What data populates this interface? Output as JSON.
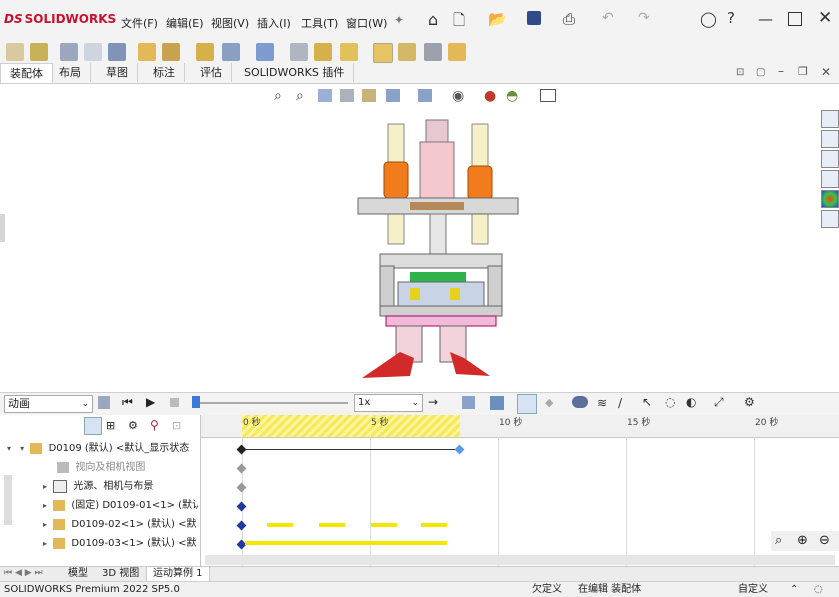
{
  "app": {
    "logo_text": "SOLIDWORKS",
    "menus": [
      "文件(F)",
      "编辑(E)",
      "视图(V)",
      "插入(I)",
      "工具(T)",
      "窗口(W)"
    ]
  },
  "command_tabs": [
    "装配体",
    "布局",
    "草图",
    "标注",
    "评估",
    "SOLIDWORKS 插件"
  ],
  "motion": {
    "study_type": "动画",
    "speed": "1x",
    "ruler_ticks": [
      "0 秒",
      "5 秒",
      "10 秒",
      "15 秒",
      "20 秒"
    ]
  },
  "tree": [
    {
      "label": "D0109 (默认) <默认_显示状态",
      "icon": "assembly-icon",
      "twisty": "▾",
      "indent": 0
    },
    {
      "label": "视向及相机视图",
      "icon": "camera-icon",
      "twisty": "",
      "indent": 1,
      "grey": true
    },
    {
      "label": "光源、相机与布景",
      "icon": "lights-folder-icon",
      "twisty": "▸",
      "indent": 1
    },
    {
      "label": "(固定) D0109-01<1> (默认",
      "icon": "subassembly-icon",
      "twisty": "▸",
      "indent": 1
    },
    {
      "label": "D0109-02<1> (默认) <默",
      "icon": "subassembly-icon",
      "twisty": "▸",
      "indent": 1
    },
    {
      "label": "D0109-03<1> (默认) <默",
      "icon": "subassembly-icon",
      "twisty": "▸",
      "indent": 1
    }
  ],
  "bottom_tabs": [
    "模型",
    "3D 视图",
    "运动算例 1"
  ],
  "status": {
    "product": "SOLIDWORKS Premium 2022 SP5.0",
    "state1": "欠定义",
    "state2": "在编辑 装配体",
    "units": "自定义"
  },
  "colors": {
    "accent": "#3b78d8",
    "brand_red": "#c8102e",
    "timeline_yellow": "#f5e600",
    "key_blue": "#1d3a9c"
  }
}
